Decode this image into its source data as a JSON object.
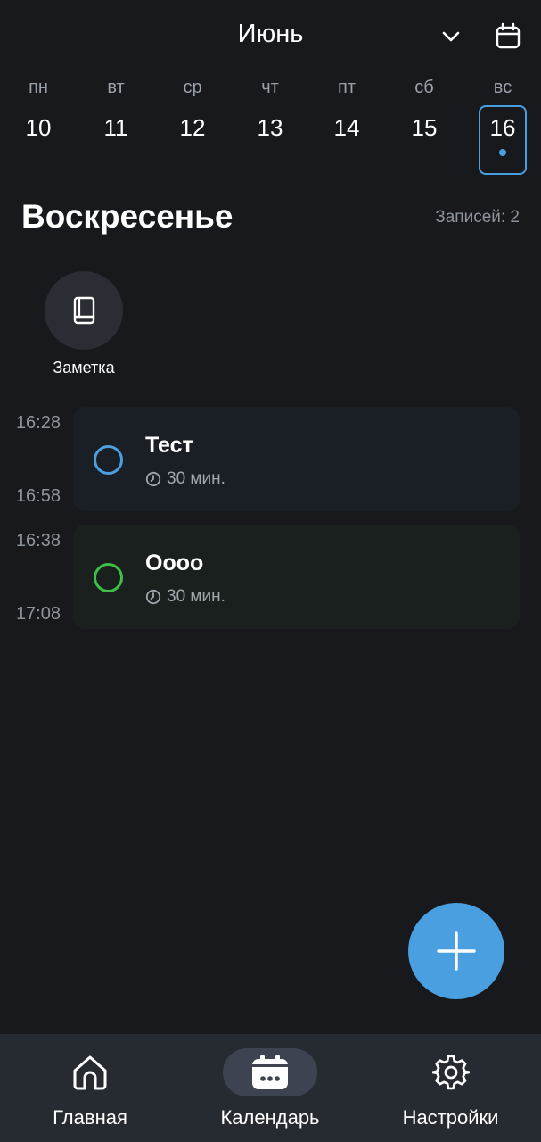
{
  "header": {
    "month": "Июнь"
  },
  "week": [
    {
      "dow": "пн",
      "num": "10"
    },
    {
      "dow": "вт",
      "num": "11"
    },
    {
      "dow": "ср",
      "num": "12"
    },
    {
      "dow": "чт",
      "num": "13"
    },
    {
      "dow": "пт",
      "num": "14"
    },
    {
      "dow": "сб",
      "num": "15"
    },
    {
      "dow": "вс",
      "num": "16"
    }
  ],
  "selected_day_index": 6,
  "day": {
    "title": "Воскресенье",
    "entries_count": "Записей: 2"
  },
  "quick_actions": [
    {
      "label": "Заметка",
      "icon": "book-icon"
    }
  ],
  "events": [
    {
      "start": "16:28",
      "end": "16:58",
      "title": "Тест",
      "duration": "30 мин.",
      "color": "#4a9fe0"
    },
    {
      "start": "16:38",
      "end": "17:08",
      "title": "Оооо",
      "duration": "30 мин.",
      "color": "#3fbf47"
    }
  ],
  "fab": {
    "icon": "plus-icon",
    "color": "#4a9fe0"
  },
  "nav": [
    {
      "label": "Главная",
      "icon": "home-icon",
      "active": false
    },
    {
      "label": "Календарь",
      "icon": "calendar-icon",
      "active": true
    },
    {
      "label": "Настройки",
      "icon": "gear-icon",
      "active": false
    }
  ],
  "colors": {
    "background": "#17191d",
    "accent": "#4a9fe0",
    "nav_background": "#262a31"
  }
}
